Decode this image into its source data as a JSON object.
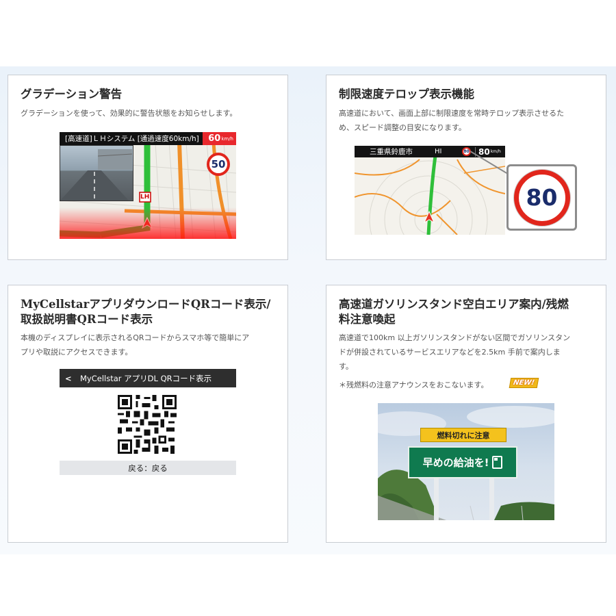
{
  "cards": [
    {
      "title": "グラデーション警告",
      "desc": "グラデーションを使って、効果的に警告状態をお知らせします。",
      "screen": {
        "bar_text": "[高速道]ＬＨシステム [通過速度60km/h]",
        "speed_value": "60",
        "speed_unit": "km/h",
        "sign_value": "50",
        "lh_label": "LH"
      }
    },
    {
      "title": "制限速度テロップ表示機能",
      "desc_lines": [
        "高速道において、画面上部に制限速度を常時テロップ表示させるた",
        "め、スピード調整の目安になります。"
      ],
      "screen": {
        "place": "三重県鈴鹿市",
        "mode": "HI",
        "small_sign": "80",
        "speed_value": "80",
        "speed_unit": "km/h",
        "zoom_sign": "80"
      }
    },
    {
      "title_lines": [
        "MyCellstarアプリダウンロードQRコード表示/",
        "取扱説明書QRコード表示"
      ],
      "desc_lines": [
        "本機のディスプレイに表示されるQRコードからスマホ等で簡単にア",
        "プリや取説にアクセスできます。"
      ],
      "screen": {
        "back_arrow": "<",
        "header": "MyCellstar アプリDL QRコード表示",
        "back_button": "戻る：戻る"
      }
    },
    {
      "title_lines": [
        "高速道ガソリンスタンド空白エリア案内/残燃",
        "料注意喚起"
      ],
      "desc_lines": [
        "高速道で100km 以上ガソリンスタンドがない区間でガソリンスタン",
        "ドが併設されているサービスエリアなどを2.5km 手前で案内しま",
        "す。"
      ],
      "note": "＊残燃料の注意アナウンスをおこないます。",
      "badge": "NEW!",
      "photo": {
        "sign_top": "燃料切れに注意",
        "sign_main": "早めの給油を!"
      }
    }
  ]
}
